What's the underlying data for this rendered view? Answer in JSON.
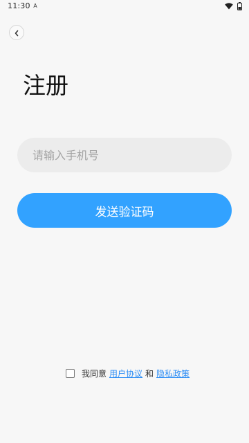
{
  "status_bar": {
    "time": "11:30",
    "notification_icon": "A"
  },
  "header": {
    "back_icon": "chevron-left"
  },
  "page": {
    "title": "注册"
  },
  "form": {
    "phone_placeholder": "请输入手机号",
    "send_code_label": "发送验证码"
  },
  "agreement": {
    "prefix": "我同意",
    "user_agreement": "用户协议",
    "conjunction": "和",
    "privacy_policy": "隐私政策"
  },
  "colors": {
    "background": "#f7f7f7",
    "accent": "#32a2ff",
    "link": "#2c8df5",
    "input_bg": "#ececec"
  }
}
